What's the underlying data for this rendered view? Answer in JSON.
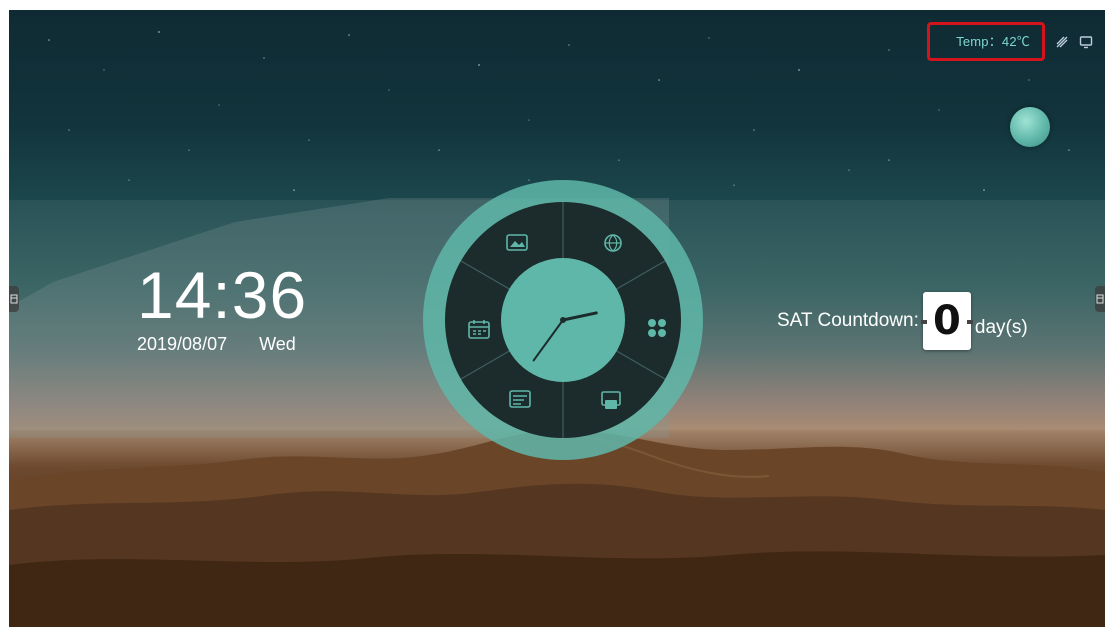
{
  "statusbar": {
    "temp_label": "Temp：42℃",
    "icons": [
      "network-icon",
      "screen-icon"
    ]
  },
  "clock": {
    "time": "14:36",
    "date": "2019/08/07",
    "weekday": "Wed"
  },
  "analog_clock": {
    "hour": 14,
    "minute": 36
  },
  "wheel": {
    "items": [
      "gallery-icon",
      "browser-icon",
      "apps-icon",
      "screen-mirror-icon",
      "whiteboard-icon",
      "calendar-icon"
    ]
  },
  "countdown": {
    "label": "SAT Countdown:",
    "value": "0",
    "unit": "day(s)"
  },
  "colors": {
    "accent": "#5fb7a9",
    "temp_highlight": "#d4141c",
    "temp_text": "#7fd7cf"
  }
}
